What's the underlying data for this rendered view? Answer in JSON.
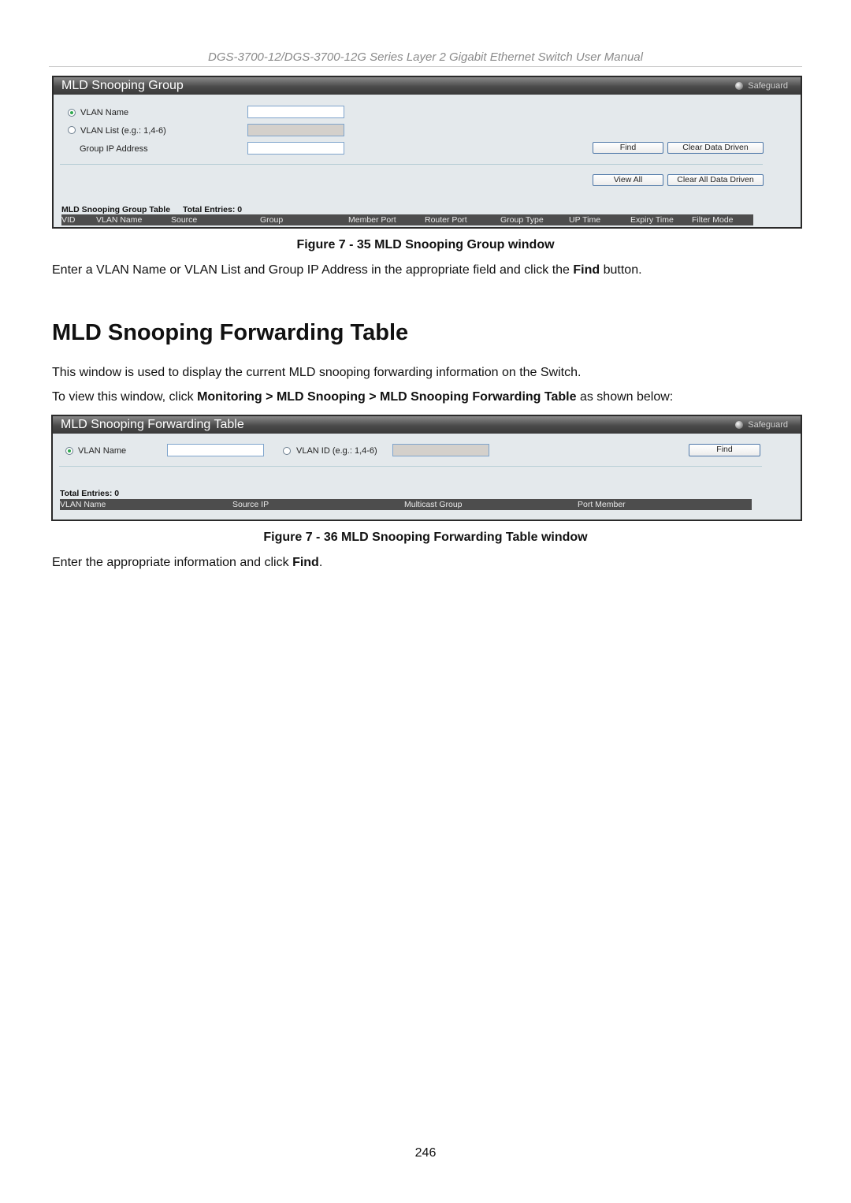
{
  "running_header": "DGS-3700-12/DGS-3700-12G Series Layer 2 Gigabit Ethernet Switch User Manual",
  "figure1": {
    "window": {
      "title": "MLD Snooping Group",
      "safeguard_label": "Safeguard",
      "fields": {
        "vlan_name": {
          "label": "VLAN Name",
          "selected": true,
          "value": ""
        },
        "vlan_list": {
          "label": "VLAN List (e.g.: 1,4-6)",
          "selected": false,
          "value": "",
          "disabled": true
        },
        "group_ip": {
          "label": "Group IP Address",
          "value": ""
        }
      },
      "buttons": {
        "find": "Find",
        "clear_data_driven": "Clear Data Driven",
        "view_all": "View All",
        "clear_all_data_driven": "Clear All Data Driven"
      },
      "table_title": "MLD Snooping Group Table",
      "total_entries": "Total Entries: 0",
      "columns": [
        "VID",
        "VLAN Name",
        "Source",
        "Group",
        "Member Port",
        "Router Port",
        "Group Type",
        "UP Time",
        "Expiry Time",
        "Filter Mode"
      ]
    },
    "caption": "Figure 7 - 35 MLD Snooping Group window"
  },
  "para1": {
    "before": "Enter a VLAN Name or VLAN List and Group IP Address in the appropriate field and click the ",
    "bold": "Find",
    "after": " button."
  },
  "section_heading": "MLD Snooping Forwarding Table",
  "para2": "This window is used to display the current MLD snooping forwarding information on the Switch.",
  "para3": {
    "before": "To view this window, click ",
    "bold": "Monitoring > MLD Snooping > MLD Snooping Forwarding Table",
    "after": " as shown below:"
  },
  "figure2": {
    "window": {
      "title": "MLD Snooping Forwarding Table",
      "safeguard_label": "Safeguard",
      "fields": {
        "vlan_name": {
          "label": "VLAN Name",
          "selected": true,
          "value": ""
        },
        "vlan_id": {
          "label": "VLAN ID (e.g.: 1,4-6)",
          "selected": false,
          "value": "",
          "disabled": true
        }
      },
      "buttons": {
        "find": "Find"
      },
      "total_entries": "Total Entries: 0",
      "columns": [
        "VLAN Name",
        "Source IP",
        "Multicast Group",
        "Port Member"
      ]
    },
    "caption": "Figure 7 - 36 MLD Snooping Forwarding Table window"
  },
  "para4": {
    "before": "Enter the appropriate information and click ",
    "bold": "Find",
    "after": "."
  },
  "page_number": "246"
}
